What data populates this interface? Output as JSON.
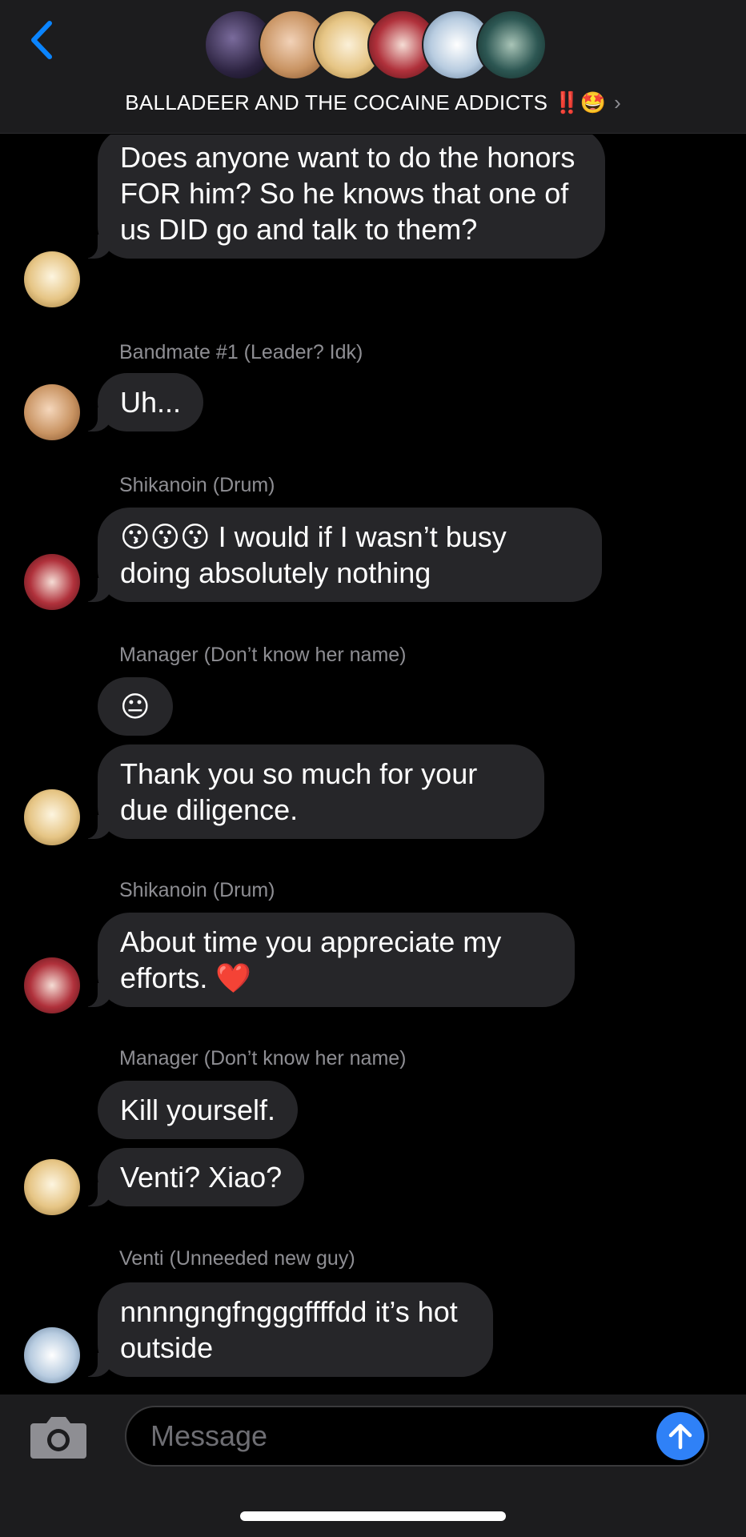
{
  "header": {
    "back_label": "Back",
    "title": "BALLADEER AND THE COCAINE ADDICTS",
    "title_emojis": "‼️🤩",
    "chevron": "›",
    "accent_color": "#0a84ff"
  },
  "messages": [
    {
      "sender": "",
      "text": "Does anyone want to do the honors FOR him? So he knows that one of us DID go and talk to them?"
    },
    {
      "sender": "Bandmate #1 (Leader? Idk)",
      "text": "Uh..."
    },
    {
      "sender": "Shikanoin (Drum)",
      "text": "😗😗😗 I would if I wasn’t busy doing absolutely nothing"
    },
    {
      "sender": "Manager (Don’t know her name)",
      "text": "😐"
    },
    {
      "sender": "",
      "text": "Thank you so much for your due diligence."
    },
    {
      "sender": "Shikanoin (Drum)",
      "text": "About time you appreciate my efforts. ❤️"
    },
    {
      "sender": "Manager (Don’t know her name)",
      "text": "Kill yourself."
    },
    {
      "sender": "",
      "text": "Venti? Xiao?"
    },
    {
      "sender": "Venti (Unneeded new guy)",
      "text": "nnnngngfngggffffdd it’s hot outside"
    }
  ],
  "composer": {
    "placeholder": "Message",
    "send_color": "#2f81f7"
  },
  "icons": {
    "back": "chevron-left-icon",
    "camera": "camera-icon",
    "send": "arrow-up-icon"
  }
}
